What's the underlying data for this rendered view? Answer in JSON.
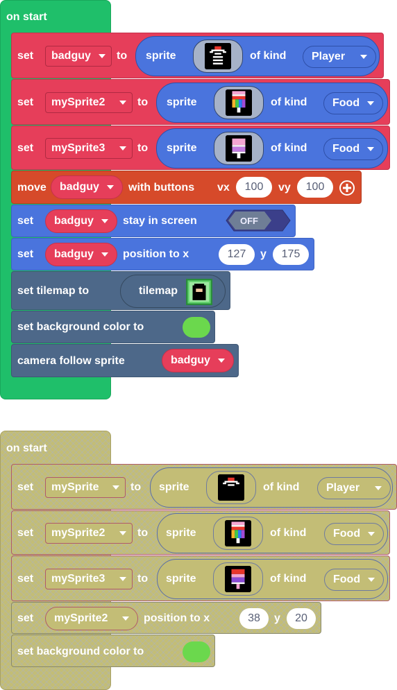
{
  "stack1": {
    "hat_label": "on start",
    "set1": {
      "set": "set",
      "var": "badguy",
      "to": "to",
      "sprite": "sprite",
      "of_kind": "of kind",
      "kind": "Player"
    },
    "set2": {
      "set": "set",
      "var": "mySprite2",
      "to": "to",
      "sprite": "sprite",
      "of_kind": "of kind",
      "kind": "Food"
    },
    "set3": {
      "set": "set",
      "var": "mySprite3",
      "to": "to",
      "sprite": "sprite",
      "of_kind": "of kind",
      "kind": "Food"
    },
    "move": {
      "move": "move",
      "var": "badguy",
      "with_buttons": "with buttons",
      "vx_label": "vx",
      "vx": "100",
      "vy_label": "vy",
      "vy": "100"
    },
    "stay": {
      "set": "set",
      "var": "badguy",
      "stay_label": "stay in screen",
      "toggle": "OFF"
    },
    "position": {
      "set": "set",
      "var": "badguy",
      "position_label": "position to x",
      "x": "127",
      "y_label": "y",
      "y": "175"
    },
    "tilemap": {
      "label": "set tilemap to",
      "tilemap": "tilemap"
    },
    "bg": {
      "label": "set background color to",
      "color": "#6bd84d"
    },
    "camera": {
      "label": "camera follow sprite",
      "var": "badguy"
    }
  },
  "stack2": {
    "hat_label": "on start",
    "set1": {
      "set": "set",
      "var": "mySprite",
      "to": "to",
      "sprite": "sprite",
      "of_kind": "of kind",
      "kind": "Player"
    },
    "set2": {
      "set": "set",
      "var": "mySprite2",
      "to": "to",
      "sprite": "sprite",
      "of_kind": "of kind",
      "kind": "Food"
    },
    "set3": {
      "set": "set",
      "var": "mySprite3",
      "to": "to",
      "sprite": "sprite",
      "of_kind": "of kind",
      "kind": "Food"
    },
    "position": {
      "set": "set",
      "var": "mySprite2",
      "position_label": "position to x",
      "x": "38",
      "y_label": "y",
      "y": "20"
    },
    "bg": {
      "label": "set background color to",
      "color": "#6bd84d"
    }
  },
  "icons": {
    "dropdown": "caret-down-icon",
    "add": "plus-circle-icon"
  }
}
